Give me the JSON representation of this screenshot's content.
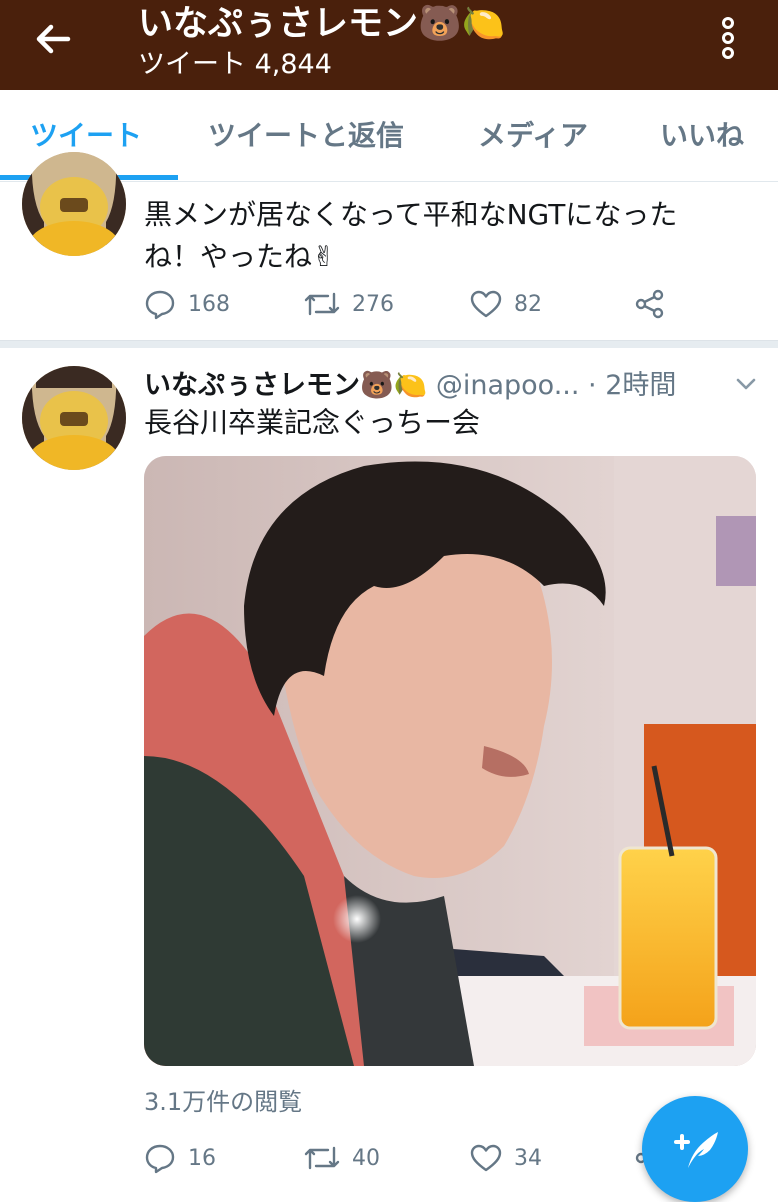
{
  "header": {
    "title": "いなぷぅさレモン🐻🍋",
    "subtitle": "ツイート 4,844"
  },
  "tabs": [
    {
      "label": "ツイート",
      "active": true
    },
    {
      "label": "ツイートと返信",
      "active": false
    },
    {
      "label": "メディア",
      "active": false
    },
    {
      "label": "いいね",
      "active": false
    }
  ],
  "tweets": [
    {
      "text_line1": "黒メンが居なくなって平和なNGTになった",
      "text_line2": "ね！やったね✌",
      "replies": "168",
      "retweets": "276",
      "likes": "82"
    },
    {
      "display_name": "いなぷぅさレモン🐻🍋",
      "handle": "@inapoo...",
      "time": "· 2時間",
      "text": "長谷川卒業記念ぐっちー会",
      "views": "3.1万件の閲覧",
      "replies": "16",
      "retweets": "40",
      "likes": "34"
    }
  ],
  "colors": {
    "header_bg": "#4a200c",
    "accent": "#1da1f2",
    "secondary_text": "#657786"
  },
  "icons": [
    "back-arrow-icon",
    "more-vertical-icon",
    "reply-icon",
    "retweet-icon",
    "like-icon",
    "share-icon",
    "chevron-down-icon",
    "compose-tweet-icon"
  ]
}
